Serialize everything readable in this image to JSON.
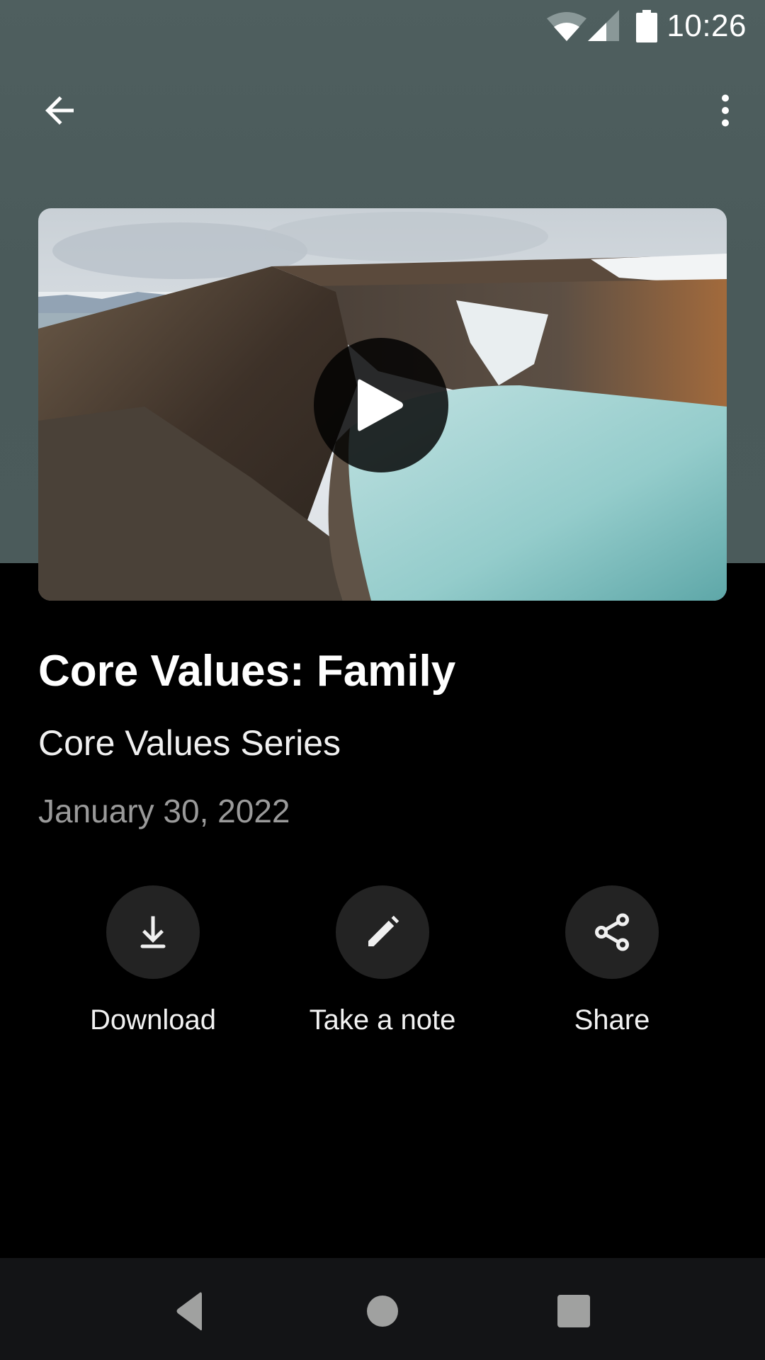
{
  "status_bar": {
    "time": "10:26",
    "icons": [
      "wifi-icon",
      "cellular-signal-icon",
      "battery-icon"
    ]
  },
  "toolbar": {
    "back_icon": "arrow-back-icon",
    "more_icon": "more-vertical-icon"
  },
  "media": {
    "thumbnail": "crater lake landscape with snow and turquoise water",
    "play_icon": "play-icon"
  },
  "content": {
    "title": "Core Values: Family",
    "series": "Core Values Series",
    "date": "January 30, 2022"
  },
  "actions": [
    {
      "label": "Download",
      "icon": "download-icon"
    },
    {
      "label": "Take a note",
      "icon": "pencil-icon"
    },
    {
      "label": "Share",
      "icon": "share-icon"
    }
  ],
  "nav_bar": {
    "buttons": [
      "nav-back",
      "nav-home",
      "nav-recents"
    ]
  },
  "colors": {
    "header": "#4b5b5b",
    "background": "#000000",
    "action_circle": "#232323",
    "date_text": "#9a9a9a",
    "nav_bar": "#131416",
    "nav_icon": "#a0a1a0"
  }
}
